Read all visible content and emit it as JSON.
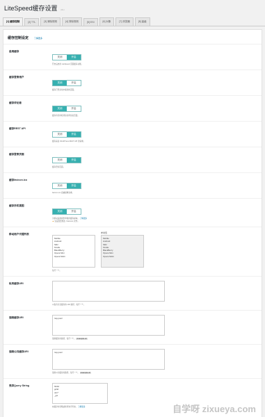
{
  "page": {
    "title": "LiteSpeed缓存设置",
    "version": "v3.x"
  },
  "tabs": [
    {
      "label": "[1] 缓存控制"
    },
    {
      "label": "[2] TTL"
    },
    {
      "label": "[3] 清除规则"
    },
    {
      "label": "[4] 排除规则"
    },
    {
      "label": "[5] ESI"
    },
    {
      "label": "[6] 对象"
    },
    {
      "label": "[7] 浏览器"
    },
    {
      "label": "[8] 高级"
    }
  ],
  "section": {
    "title": "缓存控制设定",
    "link": "了解更多"
  },
  "toggle_labels": {
    "off": "关闭",
    "on": "开启"
  },
  "rows": {
    "cache": {
      "label": "启用缓存",
      "desc": "开启后启用 LiteSpeed 页面缓存功能。"
    },
    "logged": {
      "label": "缓存登录用户",
      "desc": "缓存已登录用户看到的页面。"
    },
    "commenters": {
      "label": "缓存评论者",
      "desc": "缓存有待审核评论的评论者页面。"
    },
    "rest": {
      "label": "缓存REST API",
      "desc": "缓存来自 WordPress REST API 的请求。"
    },
    "login": {
      "label": "缓存登录页面",
      "desc": "缓存登录页面。"
    },
    "favicon": {
      "label": "缓存favicon.ico",
      "desc": "favicon.ico 会被频繁请求。"
    },
    "mobile": {
      "label": "缓存手机视图",
      "desc": "为移动设备提供单独的缓存副本。",
      "link": "了解更多",
      "warn": "该设置会修改 .htaccess 文件。"
    },
    "ualist": {
      "label": "移动用户代理列表",
      "desc": "每行一个。"
    }
  },
  "mobile_agents": {
    "header": "",
    "items": [
      "Mobile",
      "Android",
      "Silk/",
      "Kindle",
      "BlackBerry",
      "Opera Mini",
      "Opera Mobi"
    ]
  },
  "mobile_agents_ro": {
    "header": "参考值",
    "items": [
      "Mobile",
      "Android",
      "Silk/",
      "Kindle",
      "BlackBerry",
      "Opera Mini",
      "Opera Mobi"
    ]
  },
  "private_uri": {
    "label": "私有缓存URI",
    "value": "",
    "desc": "以私有方式缓存的 URI 路径，每行一个。"
  },
  "forced_uri": {
    "label": "强制缓存URI",
    "value": "/wp-json/",
    "desc": "强制缓存的路径，每行一个。",
    "code": "/example-uri"
  },
  "forced_public_uri": {
    "label": "强制公共缓存URI",
    "value": "/wp-json/",
    "desc": "强制公共缓存的路径，每行一个。",
    "code": "/example-uri"
  },
  "drop_qs": {
    "label": "丢弃Query String",
    "items": [
      "fbclid",
      "gclid",
      "utm*",
      "_ga"
    ],
    "desc": "在缓存时忽略这些查询字符串。",
    "link": "了解更多"
  },
  "watermark": "自学呀 zixueya.com"
}
